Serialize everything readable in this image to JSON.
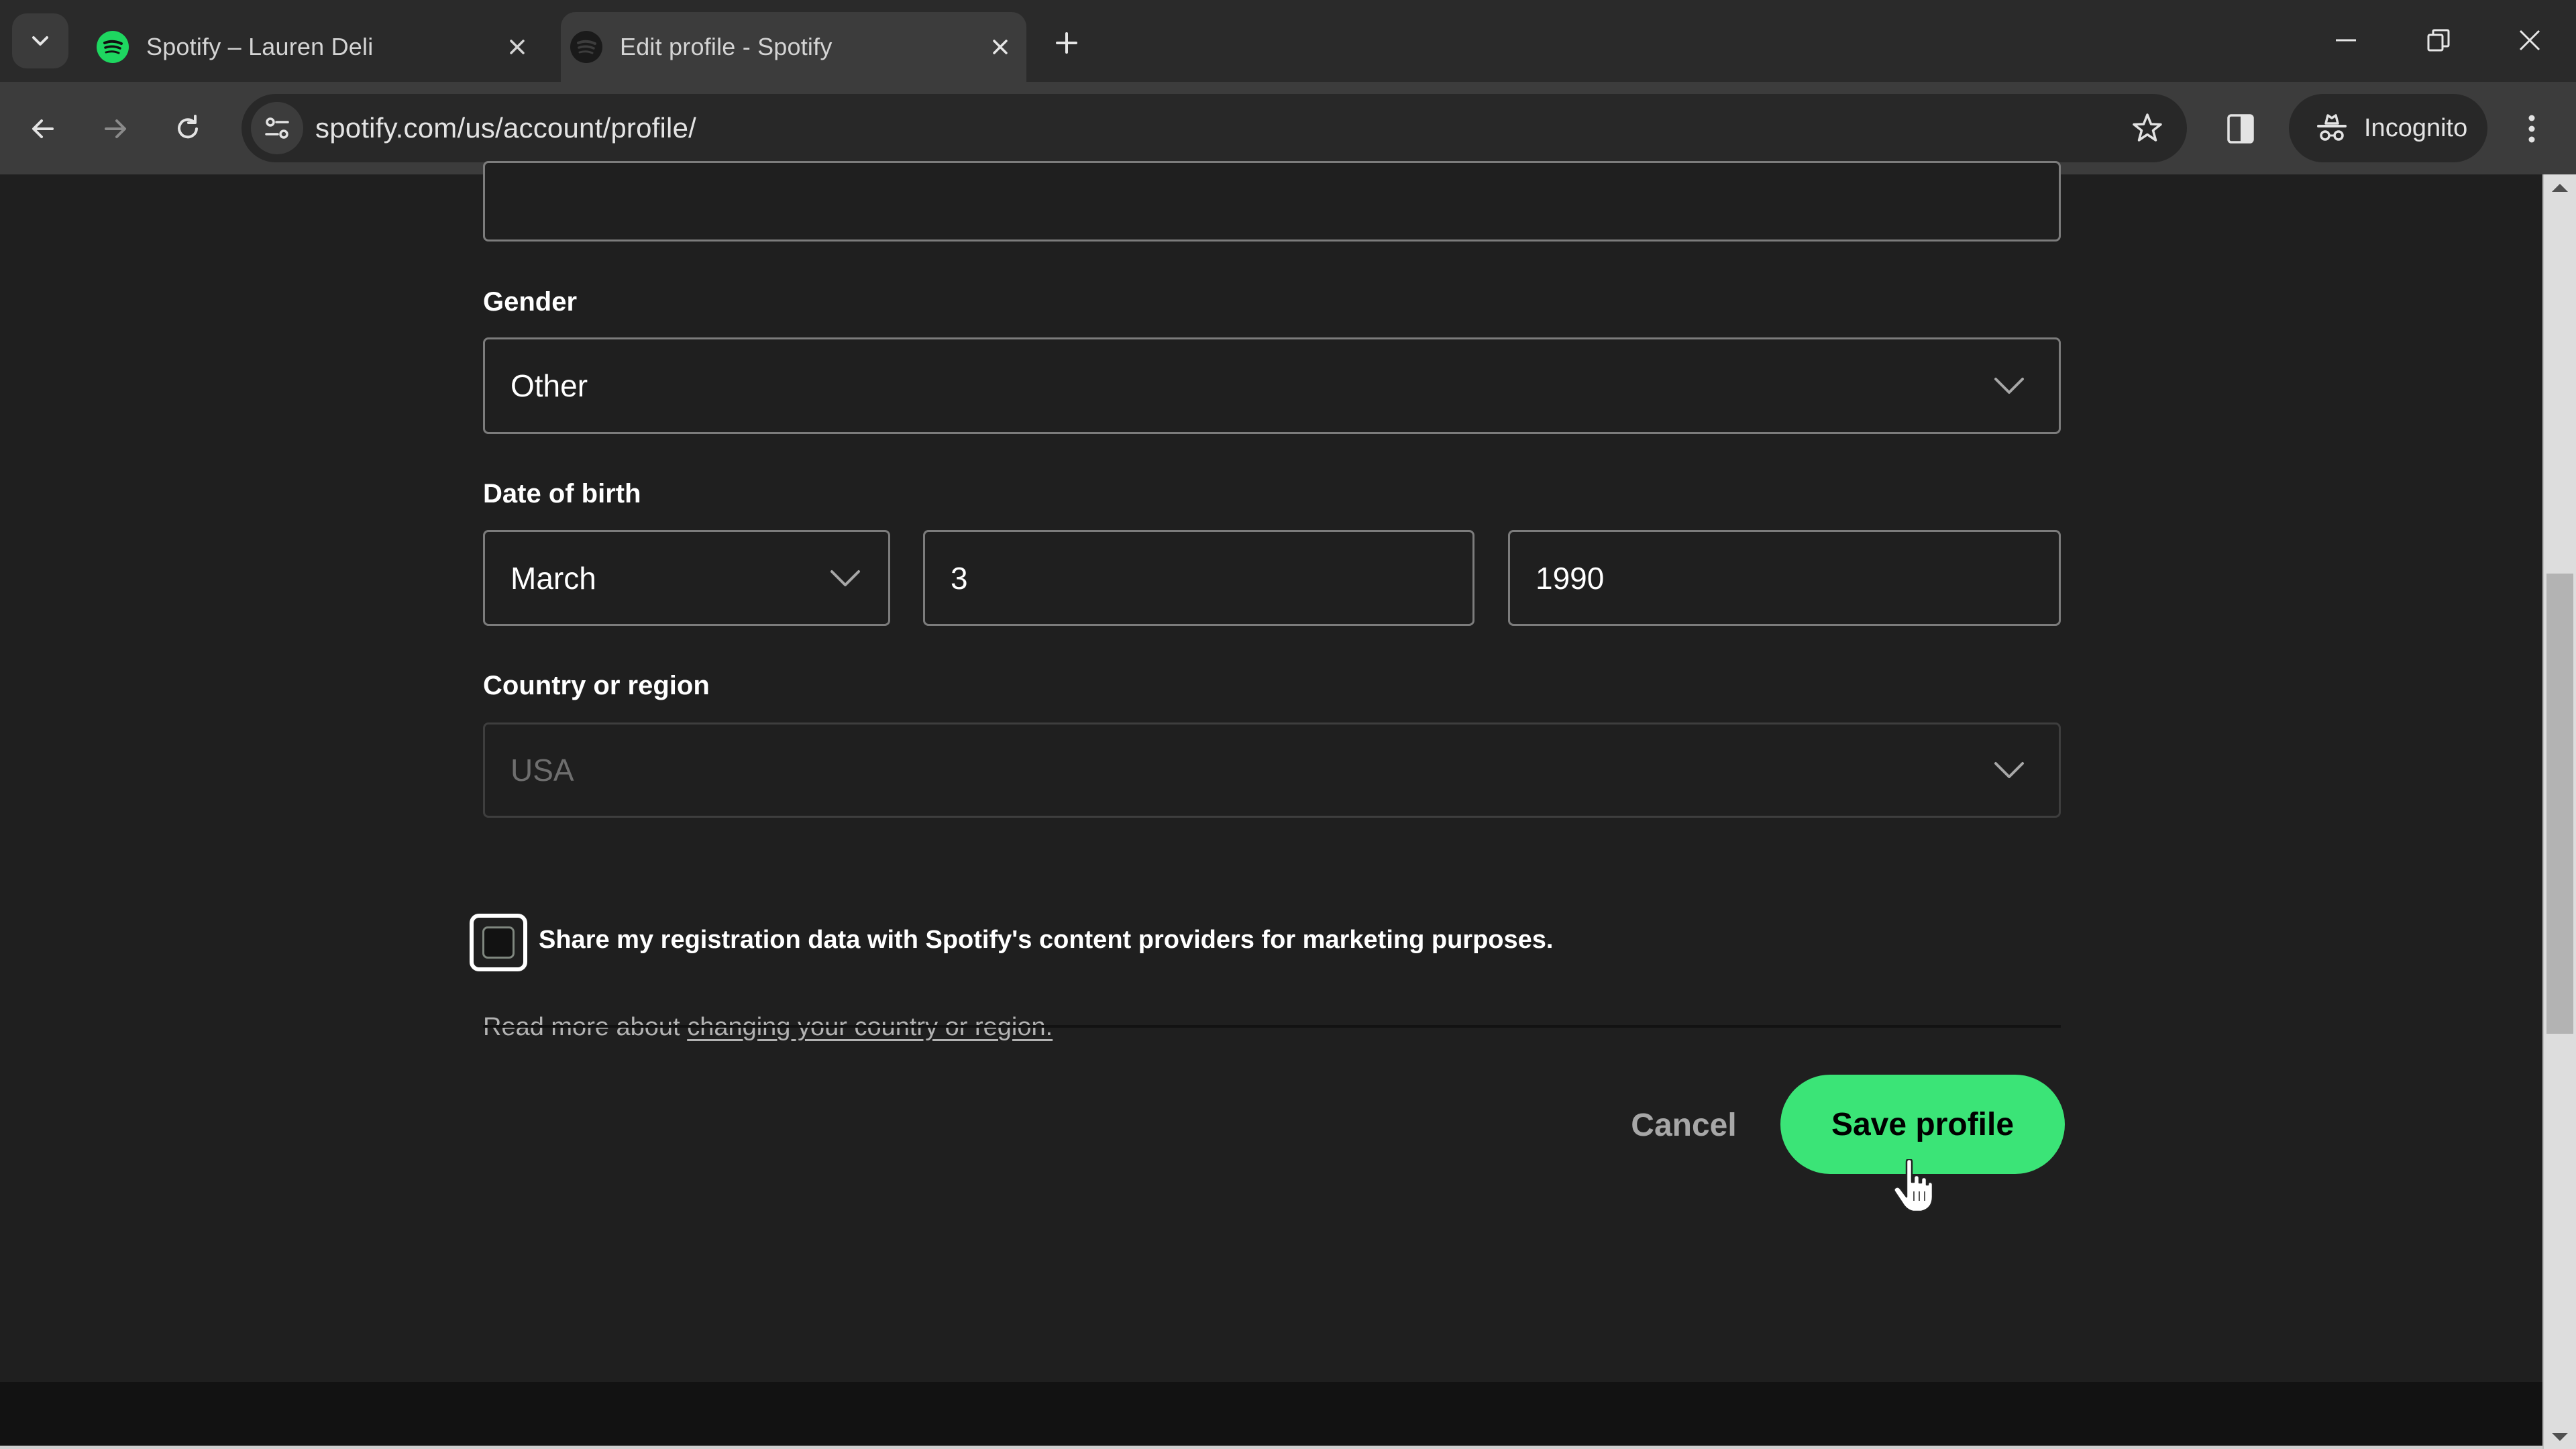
{
  "browser": {
    "tabs": [
      {
        "title": "Spotify – Lauren Deli",
        "active": false,
        "favicon": "spotify-logo-green"
      },
      {
        "title": "Edit profile - Spotify",
        "active": true,
        "favicon": "spotify-logo-dark"
      }
    ],
    "url": "spotify.com/us/account/profile/",
    "incognito_label": "Incognito",
    "icons": {
      "tab_search": "chevron-down-icon",
      "new_tab": "plus-icon",
      "back": "arrow-left-icon",
      "forward": "arrow-right-icon",
      "reload": "reload-icon",
      "site_info": "tune-icon",
      "bookmark": "star-icon",
      "side_panel": "side-panel-icon",
      "incognito": "incognito-icon",
      "menu": "kebab-menu-icon",
      "minimize": "minimize-icon",
      "restore": "restore-icon",
      "close": "close-icon"
    }
  },
  "form": {
    "gender": {
      "label": "Gender",
      "value": "Other"
    },
    "date_of_birth": {
      "label": "Date of birth",
      "month": "March",
      "day": "3",
      "year": "1990"
    },
    "country": {
      "label": "Country or region",
      "value": "USA",
      "disabled": true,
      "help_prefix": "Read more about ",
      "help_link": "changing your country or region."
    },
    "marketing_consent": {
      "label": "Share my registration data with Spotify's content providers for marketing purposes.",
      "checked": false
    },
    "actions": {
      "cancel_label": "Cancel",
      "save_label": "Save profile"
    }
  },
  "scrollbar": {
    "thumb_start_fraction": 0.313,
    "thumb_end_fraction": 0.674
  },
  "colors": {
    "spotify_green": "#3be477",
    "page_bg": "#1f1f1f",
    "footer_bg": "#121212",
    "field_border": "#7c7c7c"
  }
}
